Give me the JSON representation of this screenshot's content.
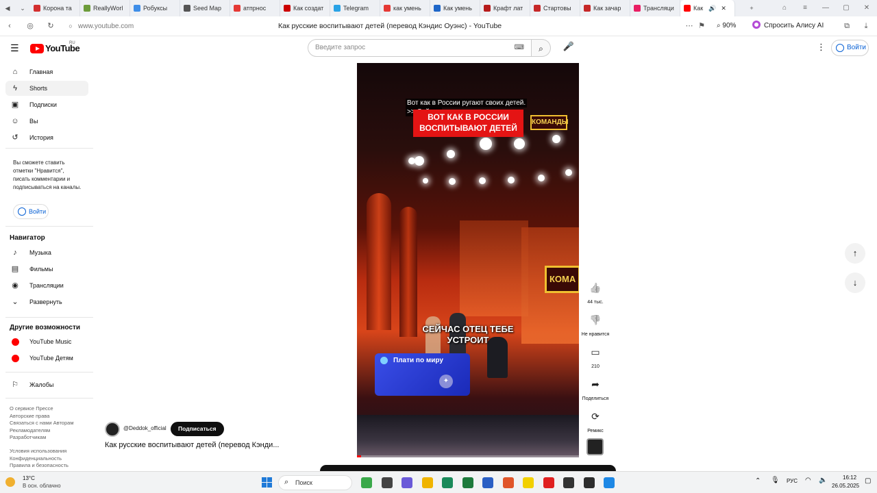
{
  "browser": {
    "tabs": [
      {
        "label": "Корона та",
        "color": "#d32f2f"
      },
      {
        "label": "ReallyWorl",
        "color": "#6d9c3b"
      },
      {
        "label": "Робуксы",
        "color": "#3f8ee8"
      },
      {
        "label": "Seed Map",
        "color": "#555555"
      },
      {
        "label": "атпрнос",
        "color": "#e53935"
      },
      {
        "label": "Как создат",
        "color": "#cc0000"
      },
      {
        "label": "Telegram",
        "color": "#2aa3e6"
      },
      {
        "label": "как умень",
        "color": "#e53935"
      },
      {
        "label": "Как умень",
        "color": "#1e66c8"
      },
      {
        "label": "Крафт лат",
        "color": "#b71c1c"
      },
      {
        "label": "Стартовы",
        "color": "#c62828"
      },
      {
        "label": "Как зачар",
        "color": "#c62828"
      },
      {
        "label": "Трансляци",
        "color": "#e91e63"
      },
      {
        "label": "Как",
        "color": "#ff0000"
      }
    ],
    "url": "www.youtube.com",
    "page_title": "Как русские воспитывают детей (перевод Кэндис Оуэнс) - YouTube",
    "zoom": "90%",
    "alice_label": "Спросить Алису AI"
  },
  "header": {
    "logo_text": "YouTube",
    "logo_region": "RU",
    "search_placeholder": "Введите запрос",
    "signin_label": "Войти"
  },
  "sidebar": {
    "items": [
      {
        "label": "Главная",
        "icon": "home-icon",
        "glyph": "⌂"
      },
      {
        "label": "Shorts",
        "icon": "shorts-icon",
        "glyph": "ϟ"
      },
      {
        "label": "Подписки",
        "icon": "subscriptions-icon",
        "glyph": "▣"
      },
      {
        "label": "Вы",
        "icon": "user-icon",
        "glyph": "☺"
      },
      {
        "label": "История",
        "icon": "history-icon",
        "glyph": "↺"
      }
    ],
    "signin_note": "Вы сможете ставить отметки \"Нравится\", писать комментарии и подписываться на каналы.",
    "signin_label": "Войти",
    "navigator_title": "Навигатор",
    "navigator": [
      {
        "label": "Музыка",
        "icon": "music-icon",
        "glyph": "♪"
      },
      {
        "label": "Фильмы",
        "icon": "film-icon",
        "glyph": "▤"
      },
      {
        "label": "Трансляции",
        "icon": "live-icon",
        "glyph": "◉"
      },
      {
        "label": "Развернуть",
        "icon": "chevron-down-icon",
        "glyph": "⌄"
      }
    ],
    "more_title": "Другие возможности",
    "more": [
      {
        "label": "YouTube Music",
        "icon": "youtube-music-icon"
      },
      {
        "label": "YouTube Детям",
        "icon": "youtube-kids-icon"
      }
    ],
    "report_label": "Жалобы",
    "footer_1": "О сервисе  Прессе\nАвторские права\nСвязаться с нами  Авторам\nРекламодателям\nРазработчикам",
    "footer_2": "Условия использования\nКонфиденциальность\nПравила и безопасность"
  },
  "video": {
    "subtitle_line1": "Вот как в России ругают своих детей.",
    "subtitle_line2": ">> Сейчас",
    "banner_line1": "ВОТ КАК В РОССИИ",
    "banner_line2": "ВОСПИТЫВАЮТ ДЕТЕЙ",
    "show_logo": "КОМАНДЫ",
    "side_sign": "КОМА",
    "caption_line1": "СЕЙЧАС ОТЕЦ ТЕБЕ",
    "caption_line2": "УСТРОИТ",
    "ad_text": "Плати по миру",
    "channel_handle": "@Deddok_official",
    "subscribe_label": "Подписаться",
    "title": "Как русские воспитывают детей (перевод Кэнди...",
    "progress": 0.02
  },
  "actions": [
    {
      "name": "like-button",
      "icon": "thumbs-up-icon",
      "glyph": "👍",
      "label": "44 тыс."
    },
    {
      "name": "dislike-button",
      "icon": "thumbs-down-icon",
      "glyph": "👎",
      "label": "Не нравится"
    },
    {
      "name": "comments-button",
      "icon": "comment-icon",
      "glyph": "▭",
      "label": "210"
    },
    {
      "name": "share-button",
      "icon": "share-icon",
      "glyph": "➦",
      "label": "Поделиться"
    },
    {
      "name": "remix-button",
      "icon": "remix-icon",
      "glyph": "⟳",
      "label": "Ремикс"
    }
  ],
  "taskbar": {
    "weather_temp": "13°C",
    "weather_desc": "В осн. облачно",
    "search_label": "Поиск",
    "lang": "РУС",
    "time": "16:12",
    "date": "26.05.2025"
  }
}
